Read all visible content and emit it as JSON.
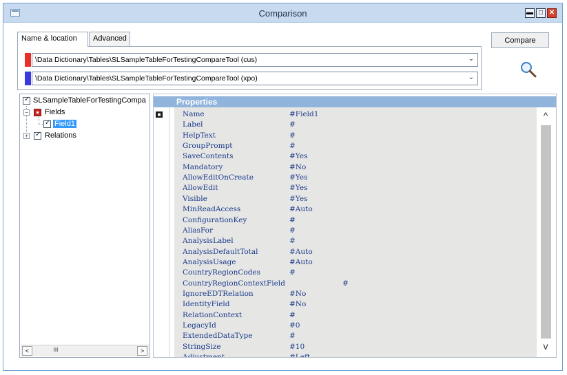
{
  "window": {
    "title": "Comparison",
    "minimize_glyph": "▬",
    "maximize_glyph": "□",
    "close_glyph": "✕"
  },
  "tabs": [
    {
      "label": "Name & location",
      "active": true
    },
    {
      "label": "Advanced",
      "active": false
    }
  ],
  "compare_button": "Compare",
  "sources": [
    {
      "path": "\\Data Dictionary\\Tables\\SLSampleTableForTestingCompareTool (cus)",
      "color": "#e8302a"
    },
    {
      "path": "\\Data Dictionary\\Tables\\SLSampleTableForTestingCompareTool (xpo)",
      "color": "#3a3ae0"
    }
  ],
  "tree": {
    "root": "SLSampleTableForTestingCompa",
    "fields": "Fields",
    "field1": "Field1",
    "relations": "Relations",
    "expander_minus": "−",
    "expander_plus": "+"
  },
  "hscroll": {
    "left": "<",
    "right": ">",
    "thumb": "III"
  },
  "vscroll": {
    "up": "^",
    "down": "v"
  },
  "properties": {
    "header": "Properties",
    "rows": [
      {
        "name": "Name",
        "value": "#Field1"
      },
      {
        "name": "Label",
        "value": "#"
      },
      {
        "name": "HelpText",
        "value": "#"
      },
      {
        "name": "GroupPrompt",
        "value": "#"
      },
      {
        "name": "SaveContents",
        "value": "#Yes"
      },
      {
        "name": "Mandatory",
        "value": "#No"
      },
      {
        "name": "AllowEditOnCreate",
        "value": "#Yes"
      },
      {
        "name": "AllowEdit",
        "value": "#Yes"
      },
      {
        "name": "Visible",
        "value": "#Yes"
      },
      {
        "name": "MinReadAccess",
        "value": "#Auto"
      },
      {
        "name": "ConfigurationKey",
        "value": "#"
      },
      {
        "name": "AliasFor",
        "value": "#"
      },
      {
        "name": "AnalysisLabel",
        "value": "#"
      },
      {
        "name": "AnalysisDefaultTotal",
        "value": "#Auto"
      },
      {
        "name": "AnalysisUsage",
        "value": "#Auto"
      },
      {
        "name": "CountryRegionCodes",
        "value": "#"
      },
      {
        "name": "CountryRegionContextField",
        "value": "#"
      },
      {
        "name": "IgnoreEDTRelation",
        "value": "#No"
      },
      {
        "name": "IdentityField",
        "value": "#No"
      },
      {
        "name": "RelationContext",
        "value": "#"
      },
      {
        "name": "LegacyId",
        "value": "#0"
      },
      {
        "name": "ExtendedDataType",
        "value": "#"
      },
      {
        "name": "StringSize",
        "value": "#10"
      },
      {
        "name": "Adjustment",
        "value": "#Left"
      }
    ]
  }
}
